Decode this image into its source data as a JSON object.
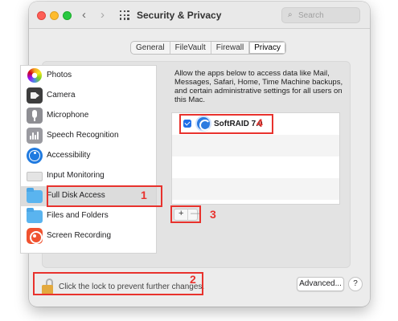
{
  "window": {
    "title": "Security & Privacy",
    "nav_back": "‹",
    "nav_forward": "›",
    "search_placeholder": "Search"
  },
  "tabs": [
    {
      "label": "General",
      "active": false
    },
    {
      "label": "FileVault",
      "active": false
    },
    {
      "label": "Firewall",
      "active": false
    },
    {
      "label": "Privacy",
      "active": true
    }
  ],
  "sidebar": {
    "items": [
      {
        "label": "Photos",
        "icon": "photos-icon"
      },
      {
        "label": "Camera",
        "icon": "camera-icon"
      },
      {
        "label": "Microphone",
        "icon": "microphone-icon"
      },
      {
        "label": "Speech Recognition",
        "icon": "speech-recognition-icon"
      },
      {
        "label": "Accessibility",
        "icon": "accessibility-icon"
      },
      {
        "label": "Input Monitoring",
        "icon": "keyboard-icon"
      },
      {
        "label": "Full Disk Access",
        "icon": "folder-icon",
        "selected": true
      },
      {
        "label": "Files and Folders",
        "icon": "folder-icon"
      },
      {
        "label": "Screen Recording",
        "icon": "screen-recording-icon"
      }
    ]
  },
  "main": {
    "description": "Allow the apps below to access data like Mail, Messages, Safari, Home, Time Machine backups, and certain administrative settings for all users on this Mac.",
    "apps": [
      {
        "name": "SoftRAID 7.0",
        "checked": true,
        "icon": "softraid-icon"
      }
    ],
    "add_label": "+",
    "remove_label": "—"
  },
  "footer": {
    "lock_text": "Click the lock to prevent further changes.",
    "advanced_label": "Advanced...",
    "help_label": "?"
  },
  "annotations": {
    "n1": "1",
    "n2": "2",
    "n3": "3",
    "n4": "4",
    "color": "#e8322d"
  },
  "colors": {
    "accent": "#1f6fe8",
    "annotation_red": "#e8322d"
  }
}
